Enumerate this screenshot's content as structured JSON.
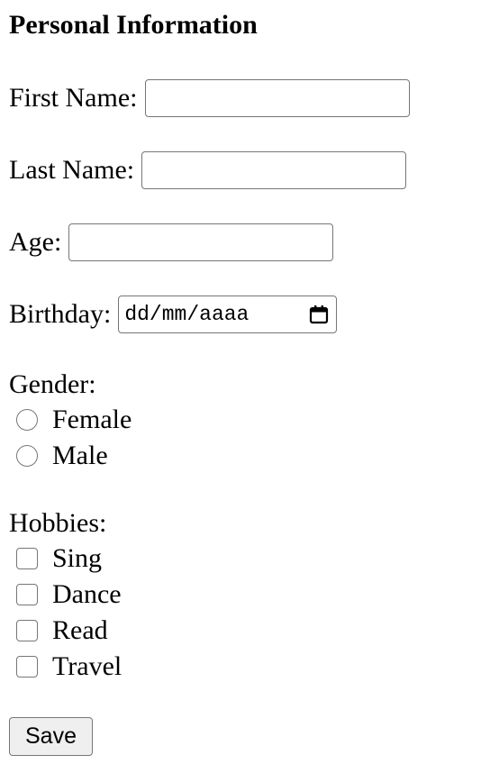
{
  "form": {
    "title": "Personal Information",
    "first_name": {
      "label": "First Name:",
      "value": ""
    },
    "last_name": {
      "label": "Last Name:",
      "value": ""
    },
    "age": {
      "label": "Age:",
      "value": ""
    },
    "birthday": {
      "label": "Birthday:",
      "placeholder": "dd/mm/aaaa",
      "icon": "calendar-icon"
    },
    "gender": {
      "label": "Gender:",
      "options": [
        {
          "label": "Female",
          "checked": false
        },
        {
          "label": "Male",
          "checked": false
        }
      ]
    },
    "hobbies": {
      "label": "Hobbies:",
      "options": [
        {
          "label": "Sing",
          "checked": false
        },
        {
          "label": "Dance",
          "checked": false
        },
        {
          "label": "Read",
          "checked": false
        },
        {
          "label": "Travel",
          "checked": false
        }
      ]
    },
    "save_label": "Save"
  }
}
